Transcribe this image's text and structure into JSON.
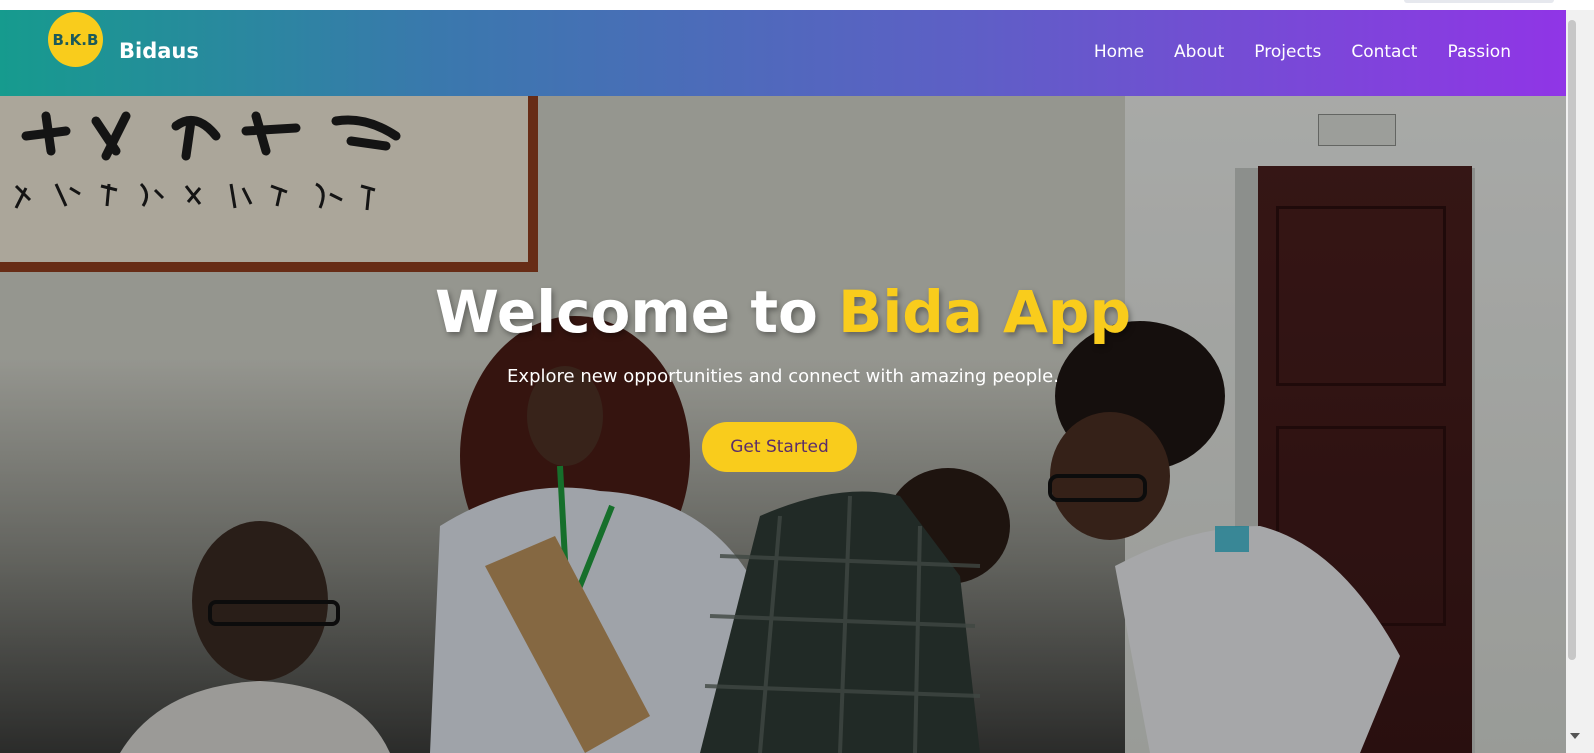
{
  "brand": {
    "logo_text": "B.K.B",
    "name": "Bidaus"
  },
  "nav": {
    "items": [
      {
        "label": "Home"
      },
      {
        "label": "About"
      },
      {
        "label": "Projects"
      },
      {
        "label": "Contact"
      },
      {
        "label": "Passion"
      }
    ]
  },
  "hero": {
    "title_prefix": "Welcome to ",
    "title_accent": "Bida App",
    "subtitle": "Explore new opportunities and connect with amazing people.",
    "cta_label": "Get Started",
    "image_description_icon": "photo-background"
  },
  "colors": {
    "accent": "#f9cc1c",
    "gradient_start": "#169b8e",
    "gradient_end": "#9035e6",
    "cta_text": "#5a2d6a"
  }
}
